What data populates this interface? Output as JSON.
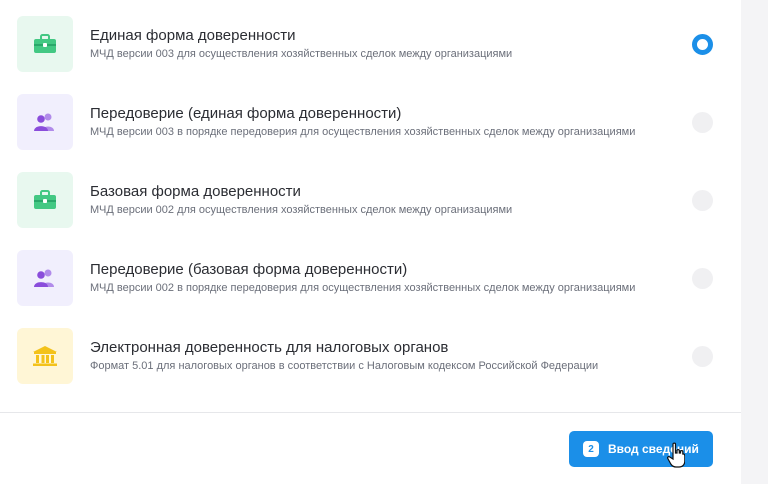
{
  "options": [
    {
      "title": "Единая форма доверенности",
      "subtitle": "МЧД версии 003 для осуществления хозяйственных сделок между организациями",
      "icon": "briefcase-icon",
      "icon_color": "#43c883",
      "selected": true
    },
    {
      "title": "Передоверие (единая форма доверенности)",
      "subtitle": "МЧД версии 003 в порядке передоверия для осуществления хозяйственных сделок между организациями",
      "icon": "users-icon",
      "icon_color": "#8a4ddb",
      "selected": false
    },
    {
      "title": "Базовая форма доверенности",
      "subtitle": "МЧД версии 002 для осуществления хозяйственных сделок между организациями",
      "icon": "briefcase-icon",
      "icon_color": "#43c883",
      "selected": false
    },
    {
      "title": "Передоверие (базовая форма доверенности)",
      "subtitle": "МЧД версии 002 в порядке передоверия для осуществления хозяйственных сделок между организациями",
      "icon": "users-icon",
      "icon_color": "#8a4ddb",
      "selected": false
    },
    {
      "title": "Электронная доверенность для налоговых органов",
      "subtitle": "Формат 5.01 для налоговых органов в соответствии с Налоговым кодексом Российской Федерации",
      "icon": "bank-icon",
      "icon_color": "#f3c21b",
      "selected": false
    }
  ],
  "footer": {
    "step_badge": "2",
    "button_label": "Ввод сведений"
  },
  "colors": {
    "accent": "#1b8fe8"
  }
}
